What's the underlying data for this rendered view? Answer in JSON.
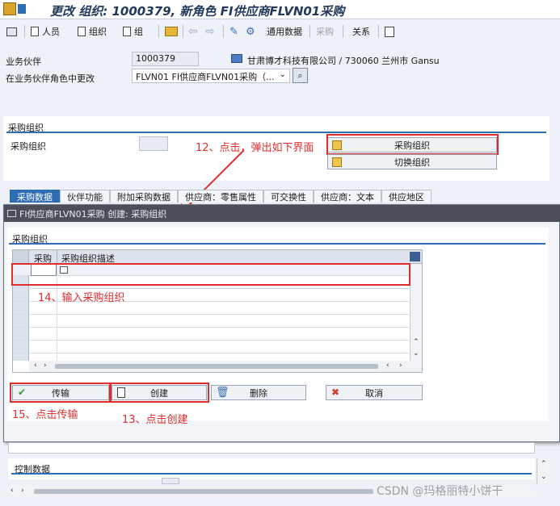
{
  "window": {
    "title": "更改 组织: 1000379, 新角色 FI供应商FLVN01采购"
  },
  "toolbar": {
    "person": "人员",
    "org": "组织",
    "group": "组",
    "general_data": "通用数据",
    "purchasing": "采购",
    "relations": "关系"
  },
  "header": {
    "bp_label": "业务伙伴",
    "bp_value": "1000379",
    "bp_desc": "甘肃博才科技有限公司 / 730060 兰州市 Gansu",
    "role_label": "在业务伙伴角色中更改",
    "role_value": "FLVN01 FI供应商FLVN01采购（..."
  },
  "purch_section": {
    "title": "采购组织",
    "field_label": "采购组织",
    "purch_org_button": "采购组织",
    "switch_org_button": "切换组织"
  },
  "annotations": {
    "a12": "12、点击，弹出如下界面",
    "a13": "13、点击创建",
    "a14": "14、输入采购组织",
    "a15": "15、点击传输"
  },
  "tabs": [
    {
      "label": "采购数据"
    },
    {
      "label": "伙伴功能"
    },
    {
      "label": "附加采购数据"
    },
    {
      "label": "供应商：零售属性"
    },
    {
      "label": "可交换性"
    },
    {
      "label": "供应商：文本"
    },
    {
      "label": "供应地区"
    }
  ],
  "dialog": {
    "title": "FI供应商FLVN01采购 创建: 采购组织",
    "section_title": "采购组织",
    "col_purch": "采购",
    "col_desc": "采购组织描述",
    "row1_value": "",
    "transfer_button": "传输",
    "create_button": "创建",
    "delete_button": "删除",
    "cancel_button": "取消"
  },
  "bottom": {
    "control_data": "控制数据"
  },
  "watermark": "CSDN @玛格丽特小饼干",
  "colors": {
    "accent": "#2b6fb8",
    "annotation_red": "#e02d2d",
    "dialog_title_bg": "#4a4f59"
  }
}
